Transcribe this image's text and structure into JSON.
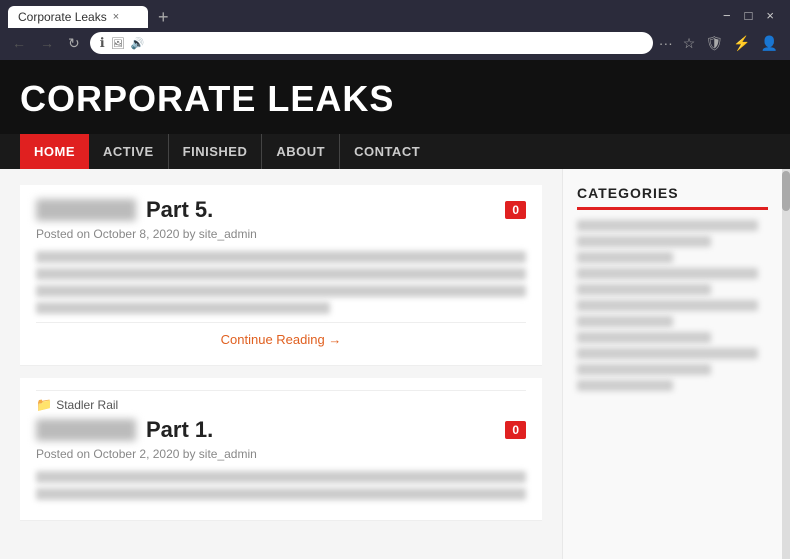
{
  "browser": {
    "tab_title": "Corporate Leaks",
    "tab_close": "×",
    "tab_new": "+",
    "win_minimize": "−",
    "win_restore": "□",
    "win_close": "×",
    "nav_back": "←",
    "nav_forward": "→",
    "nav_refresh": "↻",
    "address_text": "",
    "browser_icons": [
      "···",
      "☆",
      "🛡",
      "⚡",
      "👤"
    ]
  },
  "site": {
    "title": "CORPORATE LEAKS"
  },
  "nav": {
    "items": [
      "HOME",
      "ACTIVE",
      "FINISHED",
      "ABOUT",
      "CONTACT"
    ]
  },
  "posts": [
    {
      "title": "Part 5.",
      "meta": "Posted on October 8, 2020 by site_admin",
      "comment_count": "0",
      "continue_reading": "Continue Reading →"
    },
    {
      "title": "Part 1.",
      "meta": "Posted on October 2, 2020 by site_admin",
      "comment_count": "0",
      "category": "Stadler Rail"
    }
  ],
  "sidebar": {
    "categories_title": "CATEGORIES"
  }
}
